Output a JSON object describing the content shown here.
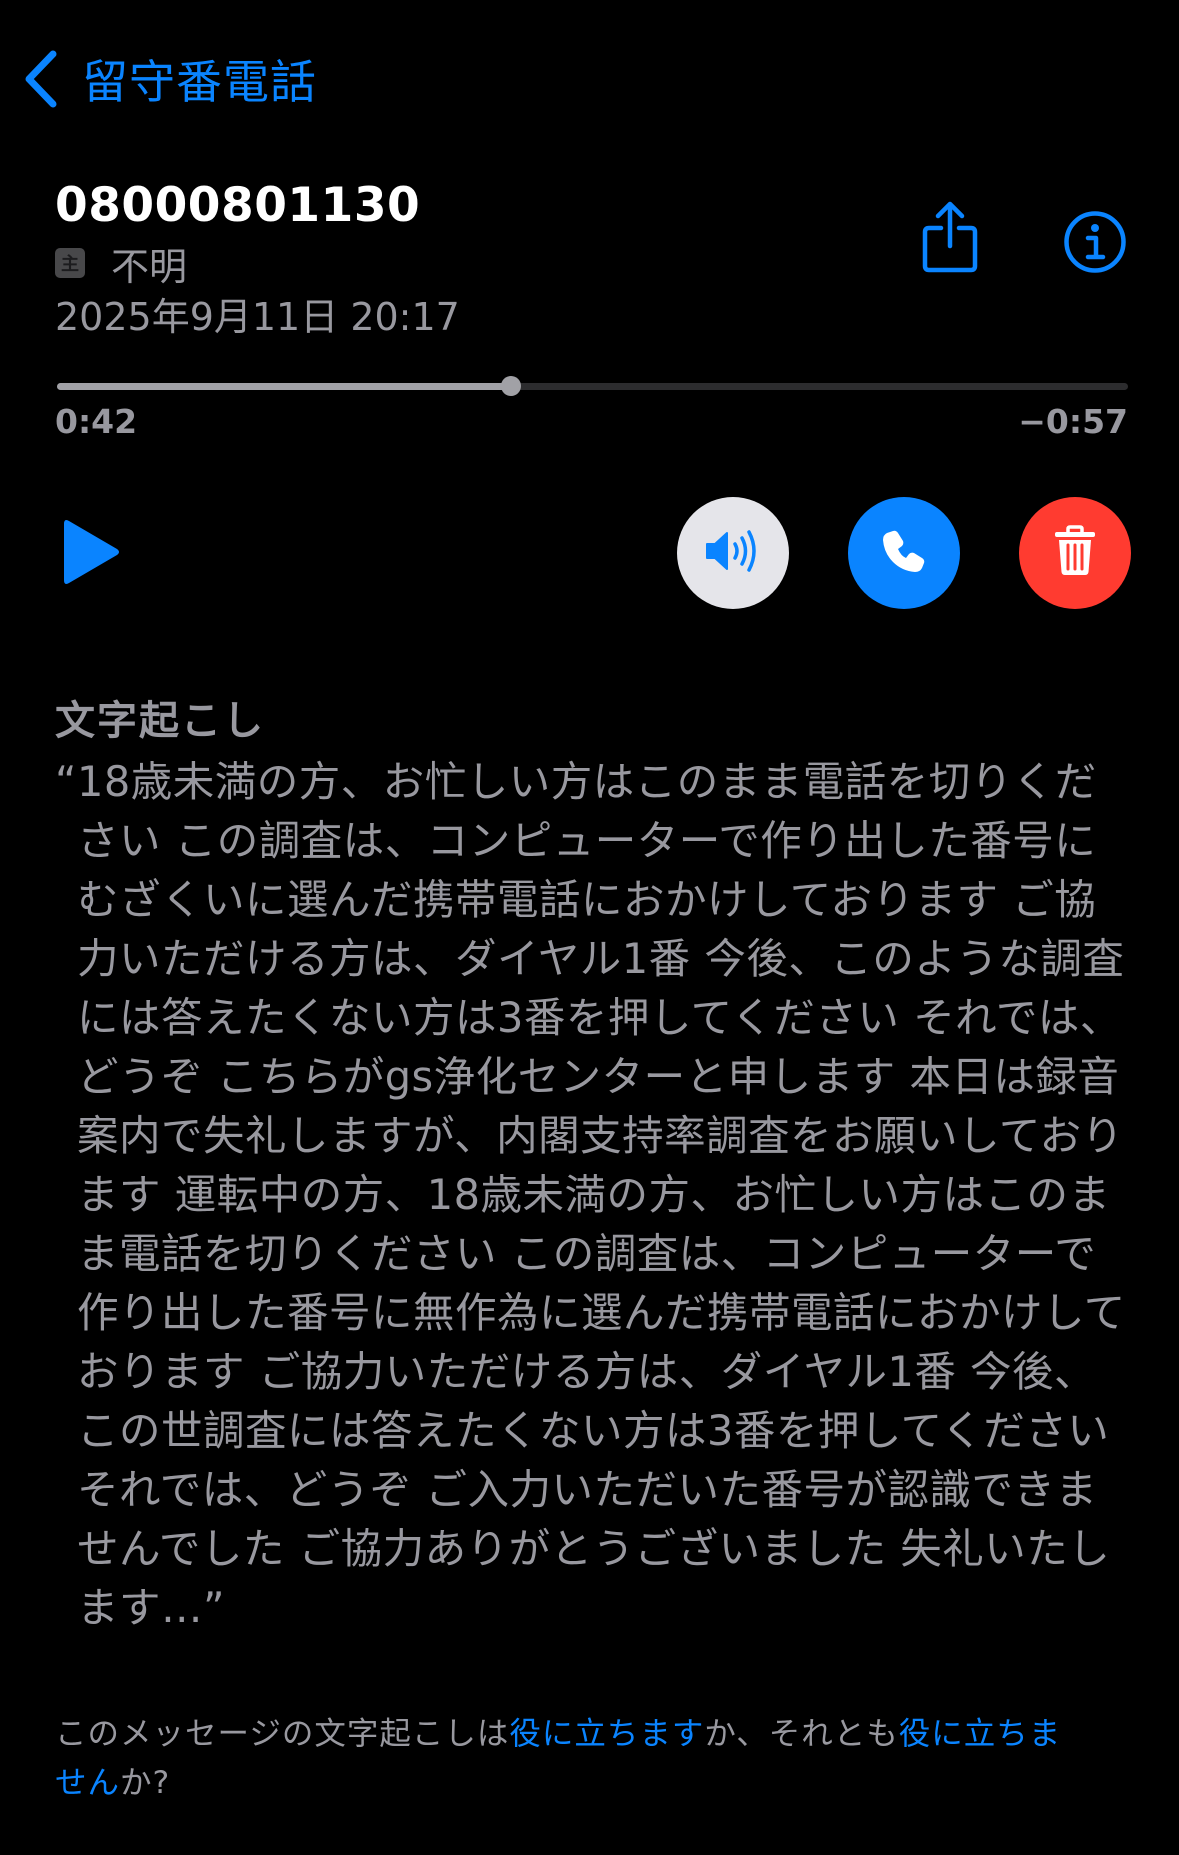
{
  "nav": {
    "back_label": "留守番電話",
    "back_icon": "chevron-left-icon"
  },
  "voicemail": {
    "number": "08000801130",
    "label_badge": "主",
    "label": "不明",
    "date": "2025年9月11日 20:17"
  },
  "header_actions": {
    "share_icon": "share-icon",
    "info_icon": "info-icon"
  },
  "player": {
    "elapsed": "0:42",
    "remaining": "−0:57",
    "progress": 0.424,
    "play_icon": "play-icon",
    "speaker_icon": "speaker-icon",
    "call_icon": "phone-icon",
    "delete_icon": "trash-icon"
  },
  "transcript": {
    "heading": "文字起こし",
    "text": "“18歳未満の方、お忙しい方はこのまま電話を切りください この調査は、コンピューターで作り出した番号にむざくいに選んだ携帯電話におかけしております ご協力いただける方は、ダイヤル1番 今後、このような調査には答えたくない方は3番を押してください それでは、どうぞ こちらがgs浄化センターと申します 本日は録音案内で失礼しますが、内閣支持率調査をお願いしております 運転中の方、18歳未満の方、お忙しい方はこのまま電話を切りください この調査は、コンピューターで作り出した番号に無作為に選んだ携帯電話におかけしております ご協力いただける方は、ダイヤル1番 今後、この世調査には答えたくない方は3番を押してください それでは、どうぞ ご入力いただいた番号が認識できませんでした ご協力ありがとうございました 失礼いたします…”"
  },
  "feedback": {
    "prefix": "このメッセージの文字起こしは",
    "helpful_link": "役に立ちます",
    "middle": "か、それとも",
    "not_helpful_link": "役に立ちません",
    "suffix": "か?"
  },
  "colors": {
    "background": "#000000",
    "accent": "#0a84ff",
    "destructive": "#ff3b30",
    "secondary_text": "#98989f",
    "speaker_button": "#e5e5ea"
  }
}
